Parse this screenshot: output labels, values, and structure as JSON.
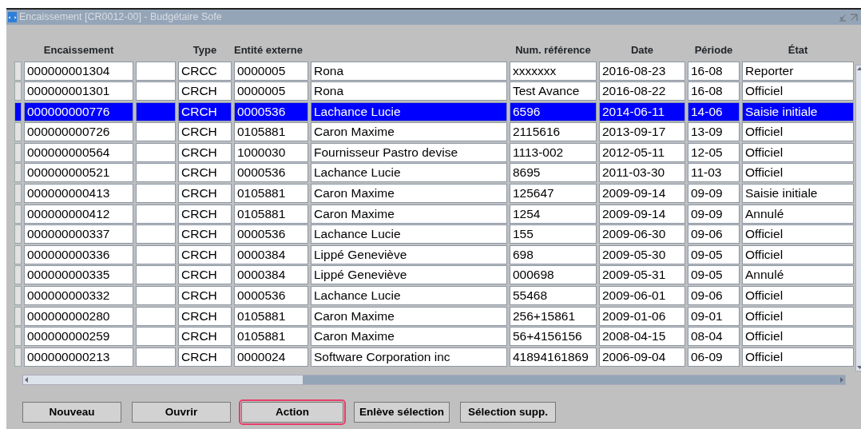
{
  "window": {
    "title": "Encaissement [CR0012-00] - Budgétaire Sofe"
  },
  "table": {
    "columns": [
      "Encaissement",
      "",
      "Type",
      "Entité externe",
      "",
      "Num. référence",
      "Date",
      "Période",
      "État"
    ],
    "rows": [
      {
        "selected": false,
        "cells": [
          "000000001304",
          "",
          "CRCC",
          "0000005",
          "Rona",
          "xxxxxxx",
          "2016-08-23",
          "16-08",
          "Reporter"
        ]
      },
      {
        "selected": false,
        "cells": [
          "000000001301",
          "",
          "CRCH",
          "0000005",
          "Rona",
          "Test Avance",
          "2016-08-22",
          "16-08",
          "Officiel"
        ]
      },
      {
        "selected": true,
        "cells": [
          "000000000776",
          "",
          "CRCH",
          "0000536",
          "Lachance Lucie",
          "6596",
          "2014-06-11",
          "14-06",
          "Saisie initiale"
        ]
      },
      {
        "selected": false,
        "cells": [
          "000000000726",
          "",
          "CRCH",
          "0105881",
          "Caron Maxime",
          "2115616",
          "2013-09-17",
          "13-09",
          "Officiel"
        ]
      },
      {
        "selected": false,
        "cells": [
          "000000000564",
          "",
          "CRCH",
          "1000030",
          "Fournisseur Pastro devise",
          "1113-002",
          "2012-05-11",
          "12-05",
          "Officiel"
        ]
      },
      {
        "selected": false,
        "cells": [
          "000000000521",
          "",
          "CRCH",
          "0000536",
          "Lachance Lucie",
          "8695",
          "2011-03-30",
          "11-03",
          "Officiel"
        ]
      },
      {
        "selected": false,
        "cells": [
          "000000000413",
          "",
          "CRCH",
          "0105881",
          "Caron Maxime",
          "125647",
          "2009-09-14",
          "09-09",
          "Saisie initiale"
        ]
      },
      {
        "selected": false,
        "cells": [
          "000000000412",
          "",
          "CRCH",
          "0105881",
          "Caron Maxime",
          "1254",
          "2009-09-14",
          "09-09",
          "Annulé"
        ]
      },
      {
        "selected": false,
        "cells": [
          "000000000337",
          "",
          "CRCH",
          "0000536",
          "Lachance Lucie",
          "155",
          "2009-06-30",
          "09-06",
          "Officiel"
        ]
      },
      {
        "selected": false,
        "cells": [
          "000000000336",
          "",
          "CRCH",
          "0000384",
          "Lippé Geneviève",
          "698",
          "2009-05-30",
          "09-05",
          "Officiel"
        ]
      },
      {
        "selected": false,
        "cells": [
          "000000000335",
          "",
          "CRCH",
          "0000384",
          "Lippé Geneviève",
          "000698",
          "2009-05-31",
          "09-05",
          "Annulé"
        ]
      },
      {
        "selected": false,
        "cells": [
          "000000000332",
          "",
          "CRCH",
          "0000536",
          "Lachance Lucie",
          "55468",
          "2009-06-01",
          "09-06",
          "Officiel"
        ]
      },
      {
        "selected": false,
        "cells": [
          "000000000280",
          "",
          "CRCH",
          "0105881",
          "Caron Maxime",
          "256+15861",
          "2009-01-06",
          "09-01",
          "Officiel"
        ]
      },
      {
        "selected": false,
        "cells": [
          "000000000259",
          "",
          "CRCH",
          "0105881",
          "Caron Maxime",
          "56+4156156",
          "2008-04-15",
          "08-04",
          "Officiel"
        ]
      },
      {
        "selected": false,
        "cells": [
          "000000000213",
          "",
          "CRCH",
          "0000024",
          "Software Corporation inc",
          "41894161869",
          "2006-09-04",
          "06-09",
          "Officiel"
        ]
      }
    ]
  },
  "buttons": [
    {
      "label": "Nouveau",
      "highlighted": false
    },
    {
      "label": "Ouvrir",
      "highlighted": false
    },
    {
      "label": "Action",
      "highlighted": true
    },
    {
      "label": "Enlève sélection",
      "highlighted": false
    },
    {
      "label": "Sélection supp.",
      "highlighted": false
    }
  ]
}
